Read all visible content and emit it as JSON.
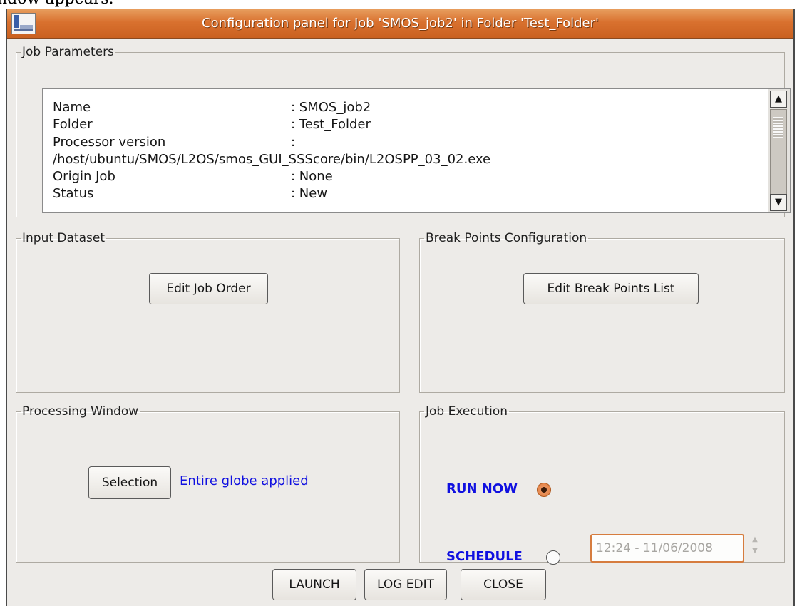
{
  "document": {
    "cut_text": "ndow appears."
  },
  "window": {
    "title": "Configuration panel for Job 'SMOS_job2' in Folder 'Test_Folder'",
    "icon": "app-logo-icon"
  },
  "job_parameters": {
    "legend": "Job Parameters",
    "rows": [
      {
        "label": "Name",
        "value": ": SMOS_job2"
      },
      {
        "label": "Folder",
        "value": ": Test_Folder"
      },
      {
        "label": "Processor version",
        "value": ":"
      },
      {
        "label": "/host/ubuntu/SMOS/L2OS/smos_GUI_SSScore/bin/L2OSPP_03_02.exe",
        "value": ""
      },
      {
        "label": "Origin Job",
        "value": ": None"
      },
      {
        "label": "Status",
        "value": ": New"
      }
    ],
    "scroll_up": "▲",
    "scroll_down": "▼"
  },
  "input_dataset": {
    "legend": "Input Dataset",
    "button": "Edit Job Order"
  },
  "break_points": {
    "legend": "Break Points Configuration",
    "button": "Edit Break Points List"
  },
  "processing_window": {
    "legend": "Processing Window",
    "button": "Selection",
    "status": "Entire globe applied"
  },
  "job_execution": {
    "legend": "Job Execution",
    "run_now": {
      "label": "RUN NOW",
      "selected": true
    },
    "schedule": {
      "label": "SCHEDULE",
      "selected": false
    },
    "datetime": "12:24 - 11/06/2008",
    "spin_up": "▲",
    "spin_down": "▼"
  },
  "footer": {
    "launch": "LAUNCH",
    "log_edit": "LOG EDIT",
    "close": "CLOSE"
  },
  "colors": {
    "titlebar": "#d9712f",
    "accent_blue": "#1010e0",
    "panel_bg": "#edebe8",
    "focus_orange": "#d67c3e"
  }
}
